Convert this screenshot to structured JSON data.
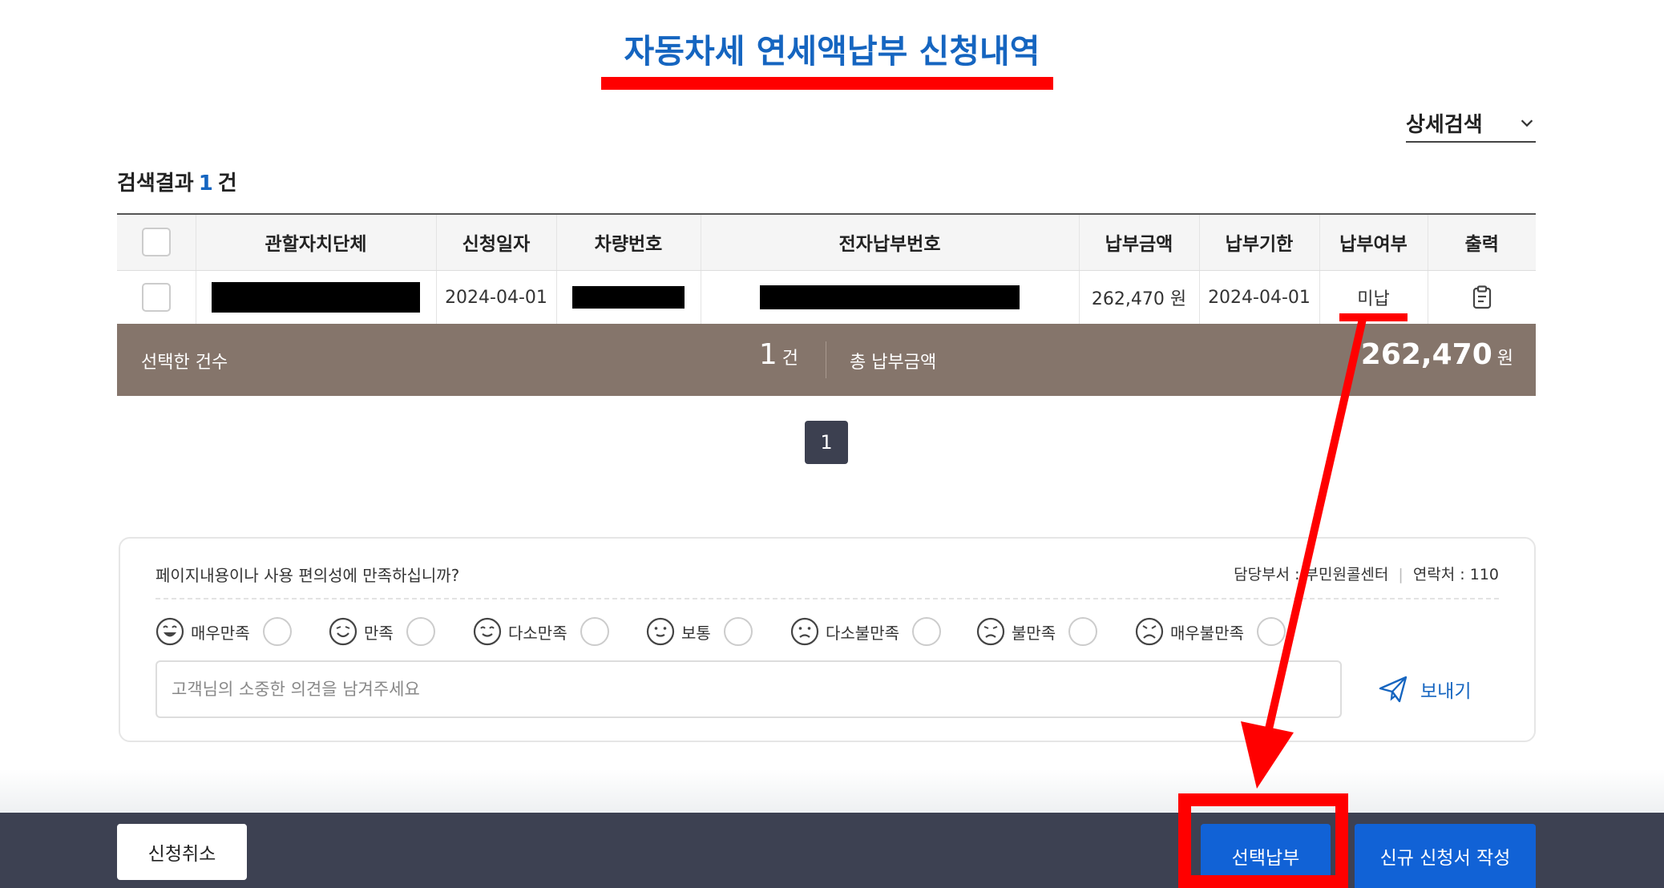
{
  "page": {
    "title": "자동차세 연세액납부 신청내역",
    "detail_search_label": "상세검색"
  },
  "results": {
    "label": "검색결과",
    "count": "1",
    "unit": "건"
  },
  "table": {
    "headers": [
      "관할자치단체",
      "신청일자",
      "차량번호",
      "전자납부번호",
      "납부금액",
      "납부기한",
      "납부여부",
      "출력"
    ],
    "rows": [
      {
        "municipality": "",
        "apply_date": "2024-04-01",
        "vehicle_no": "",
        "e_pay_no": "",
        "amount": "262,470 원",
        "due_date": "2024-04-01",
        "status": "미납"
      }
    ]
  },
  "summary": {
    "selected_label": "선택한 건수",
    "selected_count": "1",
    "count_unit": "건",
    "total_label": "총 납부금액",
    "total_amount": "262,470",
    "amount_unit": "원"
  },
  "pagination": {
    "current": "1"
  },
  "survey": {
    "question": "페이지내용이나 사용 편의성에 만족하십니까?",
    "dept_prefix": "담당부서 : ",
    "dept_name": "부민원콜센터",
    "contact": "연락처 : 110",
    "options": [
      "매우만족",
      "만족",
      "다소만족",
      "보통",
      "다소불만족",
      "불만족",
      "매우불만족"
    ],
    "placeholder": "고객님의 소중한 의견을 남겨주세요",
    "send_label": "보내기"
  },
  "actions": {
    "cancel_label": "신청취소",
    "select_pay_label": "선택납부",
    "new_application_label": "신규 신청서 작성"
  },
  "colors": {
    "accent_blue": "#1565c0",
    "button_blue": "#1162d6",
    "summary_bar": "#85756b",
    "bottom_bar": "#3d4152",
    "annotation_red": "#ff0000"
  }
}
